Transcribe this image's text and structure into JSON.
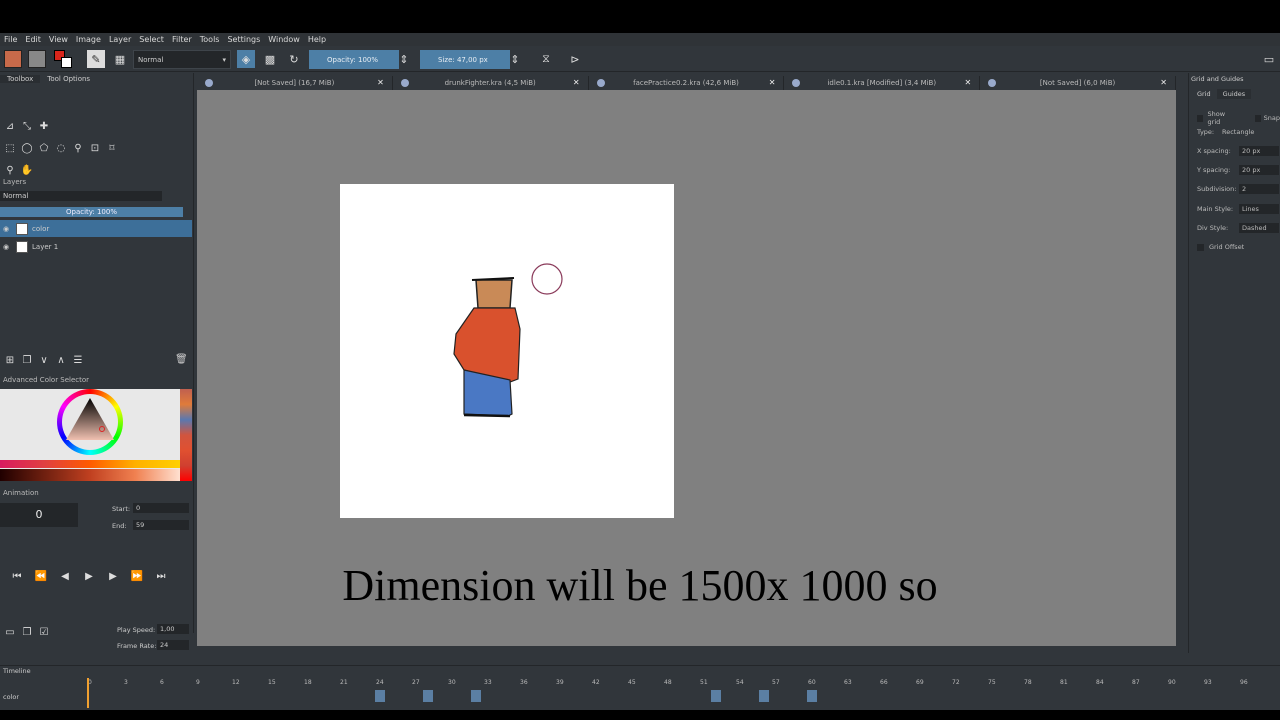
{
  "menu": [
    "File",
    "Edit",
    "View",
    "Image",
    "Layer",
    "Select",
    "Filter",
    "Tools",
    "Settings",
    "Window",
    "Help"
  ],
  "toolbar": {
    "blend_mode": "Normal",
    "opacity": "Opacity:  100%",
    "size": "Size:  47,00 px"
  },
  "left_tabs": [
    "Toolbox",
    "Tool Options"
  ],
  "layers": {
    "title": "Layers",
    "blend": "Normal",
    "opacity": "Opacity:  100%",
    "items": [
      "color",
      "Layer 1"
    ]
  },
  "color_selector_title": "Advanced Color Selector",
  "animation": {
    "title": "Animation",
    "frame": "0",
    "start_label": "Start:",
    "start": "0",
    "end_label": "End:",
    "end": "59",
    "play_speed_label": "Play Speed:",
    "play_speed": "1,00",
    "frame_rate_label": "Frame Rate:",
    "frame_rate": "24"
  },
  "doc_tabs": [
    "[Not Saved]  (16,7 MiB)",
    "drunkFighter.kra (4,5 MiB)",
    "facePractice0.2.kra (42,6 MiB)",
    "idle0.1.kra [Modified]  (3,4 MiB)",
    "[Not Saved]  (6,0 MiB)"
  ],
  "grid": {
    "title": "Grid and Guides",
    "tabs": [
      "Grid",
      "Guides"
    ],
    "show_grid": "Show grid",
    "snap": "Snap",
    "type_label": "Type:",
    "type": "Rectangle",
    "x_label": "X spacing:",
    "x": "20 px",
    "y_label": "Y spacing:",
    "y": "20 px",
    "sub_label": "Subdivision:",
    "sub": "2",
    "main_label": "Main Style:",
    "main": "Lines",
    "div_label": "Div Style:",
    "div": "Dashed",
    "offset": "Grid Offset"
  },
  "subtitle": "Dimension will be 1500x 1000 so",
  "timeline": {
    "title": "Timeline",
    "layer": "color",
    "ticks": [
      "0",
      "3",
      "6",
      "9",
      "12",
      "15",
      "18",
      "21",
      "24",
      "27",
      "30",
      "33",
      "36",
      "39",
      "42",
      "45",
      "48",
      "51",
      "54",
      "57",
      "60",
      "63",
      "66",
      "69",
      "72",
      "75",
      "78",
      "81",
      "84",
      "87",
      "90",
      "93",
      "96"
    ]
  },
  "colors": {
    "accent": "#4d7fa6",
    "shirt": "#d9512d",
    "pants": "#4a78c4",
    "head": "#c98a57"
  }
}
